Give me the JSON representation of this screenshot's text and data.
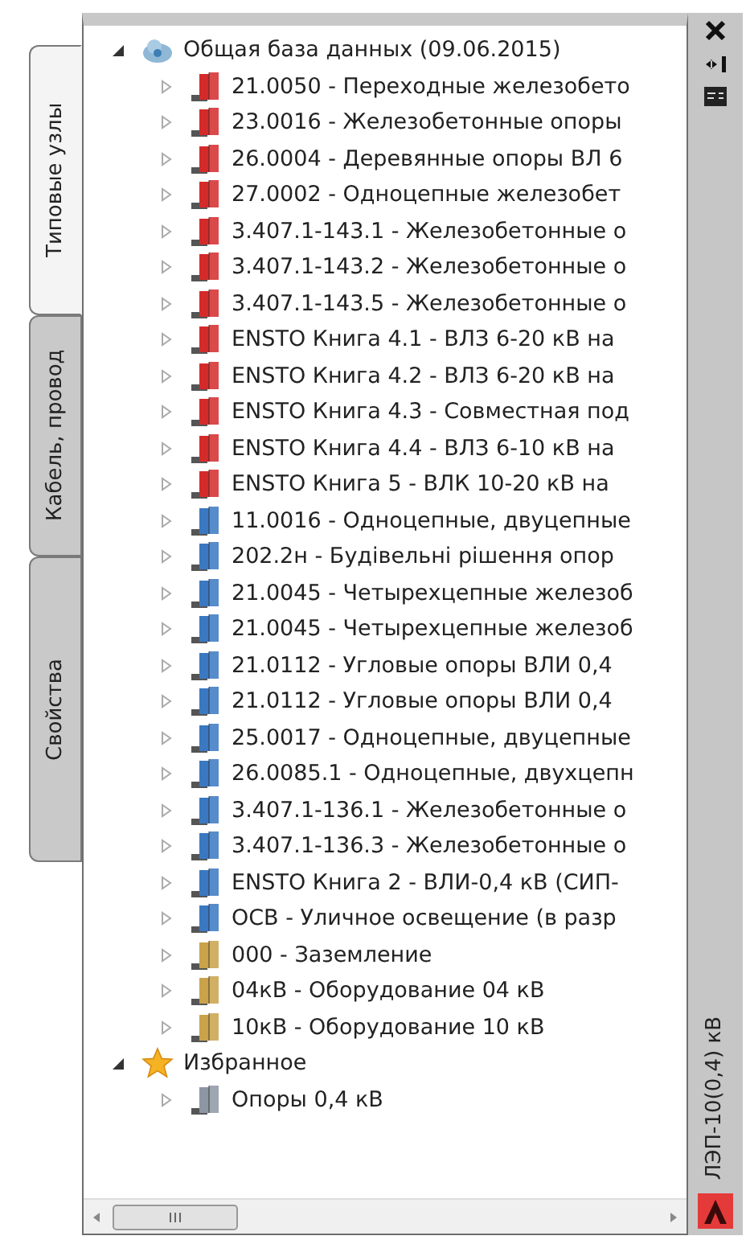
{
  "side_tabs": [
    {
      "label": "Типовые узлы",
      "selected": true
    },
    {
      "label": "Кабель, провод",
      "selected": false
    },
    {
      "label": "Свойства",
      "selected": false
    }
  ],
  "tree": [
    {
      "label": "Общая база данных  (09.06.2015)",
      "kind": "database",
      "expanded": true,
      "children": [
        {
          "label": "21.0050 - Переходные железобето",
          "color": "#d42a2a",
          "expanded": false
        },
        {
          "label": "23.0016 - Железобетонные опоры",
          "color": "#d42a2a",
          "expanded": false
        },
        {
          "label": "26.0004 - Деревянные опоры ВЛ 6",
          "color": "#d42a2a",
          "expanded": false
        },
        {
          "label": "27.0002 - Одноцепные железобет",
          "color": "#d42a2a",
          "expanded": false
        },
        {
          "label": "3.407.1-143.1 - Железобетонные о",
          "color": "#d42a2a",
          "expanded": false
        },
        {
          "label": "3.407.1-143.2 - Железобетонные о",
          "color": "#d42a2a",
          "expanded": false
        },
        {
          "label": "3.407.1-143.5 - Железобетонные о",
          "color": "#d42a2a",
          "expanded": false
        },
        {
          "label": "ENSTO Книга 4.1 - ВЛЗ 6-20 кВ на",
          "color": "#d42a2a",
          "expanded": false
        },
        {
          "label": "ENSTO Книга 4.2 - ВЛЗ 6-20 кВ на",
          "color": "#d42a2a",
          "expanded": false
        },
        {
          "label": "ENSTO Книга 4.3 - Совместная под",
          "color": "#d42a2a",
          "expanded": false
        },
        {
          "label": "ENSTO Книга 4.4 - ВЛЗ 6-10 кВ на",
          "color": "#d42a2a",
          "expanded": false
        },
        {
          "label": "ENSTO Книга 5 - ВЛК 10-20 кВ на",
          "color": "#d42a2a",
          "expanded": false
        },
        {
          "label": "11.0016 - Одноцепные, двуцепные",
          "color": "#3a78c2",
          "expanded": false
        },
        {
          "label": "202.2н - Будівельні рішення опор",
          "color": "#3a78c2",
          "expanded": false
        },
        {
          "label": "21.0045 - Четырехцепные железоб",
          "color": "#3a78c2",
          "expanded": false
        },
        {
          "label": "21.0045 - Четырехцепные железоб",
          "color": "#3a78c2",
          "expanded": false
        },
        {
          "label": "21.0112 - Угловые опоры ВЛИ 0,4",
          "color": "#3a78c2",
          "expanded": false
        },
        {
          "label": "21.0112 - Угловые опоры ВЛИ 0,4",
          "color": "#3a78c2",
          "expanded": false
        },
        {
          "label": "25.0017 - Одноцепные, двуцепные",
          "color": "#3a78c2",
          "expanded": false
        },
        {
          "label": "26.0085.1 - Одноцепные, двухцепн",
          "color": "#3a78c2",
          "expanded": false
        },
        {
          "label": "3.407.1-136.1 - Железобетонные о",
          "color": "#3a78c2",
          "expanded": false
        },
        {
          "label": "3.407.1-136.3 - Железобетонные о",
          "color": "#3a78c2",
          "expanded": false
        },
        {
          "label": "ENSTO Книга 2 - ВЛИ-0,4 кВ (СИП-",
          "color": "#3a78c2",
          "expanded": false
        },
        {
          "label": "ОСВ - Уличное освещение (в разр",
          "color": "#3a78c2",
          "expanded": false
        },
        {
          "label": "000 - Заземление",
          "color": "#c9a24a",
          "expanded": false
        },
        {
          "label": "04кВ - Оборудование 04 кВ",
          "color": "#c9a24a",
          "expanded": false
        },
        {
          "label": "10кВ - Оборудование 10 кВ",
          "color": "#c9a24a",
          "expanded": false
        }
      ]
    },
    {
      "label": "Избранное",
      "kind": "favorites",
      "expanded": true,
      "children": [
        {
          "label": "Опоры 0,4 кВ",
          "color": "#8d96a3",
          "expanded": false
        }
      ]
    }
  ],
  "palette_title": "ЛЭП-10(0,4) кВ"
}
